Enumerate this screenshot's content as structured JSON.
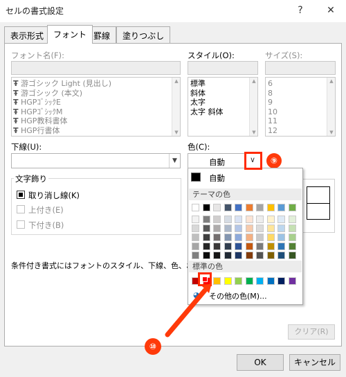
{
  "window": {
    "title": "セルの書式設定",
    "help_label": "?",
    "close_label": "✕"
  },
  "tabs": [
    {
      "label": "表示形式",
      "active": false
    },
    {
      "label": "フォント",
      "active": true
    },
    {
      "label": "罫線",
      "active": false
    },
    {
      "label": "塗りつぶし",
      "active": false
    }
  ],
  "font": {
    "label": "フォント名(F):",
    "items": [
      "游ゴシック Light (見出し)",
      "游ゴシック (本文)",
      "HGPｺﾞｼｯｸE",
      "HGPｺﾞｼｯｸM",
      "HGP教科書体",
      "HGP行書体"
    ]
  },
  "style": {
    "label": "スタイル(O):",
    "items": [
      "標準",
      "斜体",
      "太字",
      "太字 斜体"
    ]
  },
  "size": {
    "label": "サイズ(S):",
    "items": [
      "6",
      "8",
      "9",
      "10",
      "11",
      "12"
    ]
  },
  "underline": {
    "label": "下線(U):",
    "value": ""
  },
  "color": {
    "label": "色(C):",
    "value": "自動"
  },
  "effects": {
    "title": "文字飾り",
    "strikethrough": "取り消し線(K)",
    "superscript": "上付き(E)",
    "subscript": "下付き(B)"
  },
  "notice": "条件付き書式にはフォントのスタイル、下線、色、および取",
  "palette": {
    "auto_label": "自動",
    "theme_header": "テーマの色",
    "standard_header": "標準の色",
    "more_colors": "その他の色(M)...",
    "theme_top": [
      "#ffffff",
      "#000000",
      "#e7e6e6",
      "#44546a",
      "#4472c4",
      "#ed7d31",
      "#a5a5a5",
      "#ffc000",
      "#5b9bd5",
      "#70ad47"
    ],
    "theme_shades": [
      [
        "#f2f2f2",
        "#7f7f7f",
        "#d0cece",
        "#d6dce4",
        "#d9e2f3",
        "#fbe4d5",
        "#ededed",
        "#fff2cc",
        "#deeaf6",
        "#e2efd9"
      ],
      [
        "#d8d8d8",
        "#595959",
        "#aeabab",
        "#adb9ca",
        "#b4c6e7",
        "#f7caac",
        "#dbdbdb",
        "#fee599",
        "#bdd7ee",
        "#c5e0b3"
      ],
      [
        "#bfbfbf",
        "#3f3f3f",
        "#757070",
        "#8496b0",
        "#8eaadb",
        "#f4b083",
        "#c9c9c9",
        "#ffd965",
        "#9cc3e5",
        "#a8d08d"
      ],
      [
        "#a5a5a5",
        "#262626",
        "#3a3838",
        "#323f4f",
        "#2f5496",
        "#c45911",
        "#7b7b7b",
        "#bf8f00",
        "#2e75b5",
        "#538135"
      ],
      [
        "#7f7f7f",
        "#0c0c0c",
        "#171616",
        "#222a35",
        "#1f3864",
        "#833c0b",
        "#525252",
        "#7f5f00",
        "#1e4e79",
        "#375623"
      ]
    ],
    "standard": [
      "#c00000",
      "#ff0000",
      "#ffc000",
      "#ffff00",
      "#92d050",
      "#00b050",
      "#00b0f0",
      "#0070c0",
      "#002060",
      "#7030a0"
    ]
  },
  "preview_clear_label": "クリア(R)",
  "buttons": {
    "ok": "OK",
    "cancel": "キャンセル"
  },
  "annotations": {
    "step9": "⑨",
    "step10": "⑩"
  },
  "accent": "#ff3a0a"
}
